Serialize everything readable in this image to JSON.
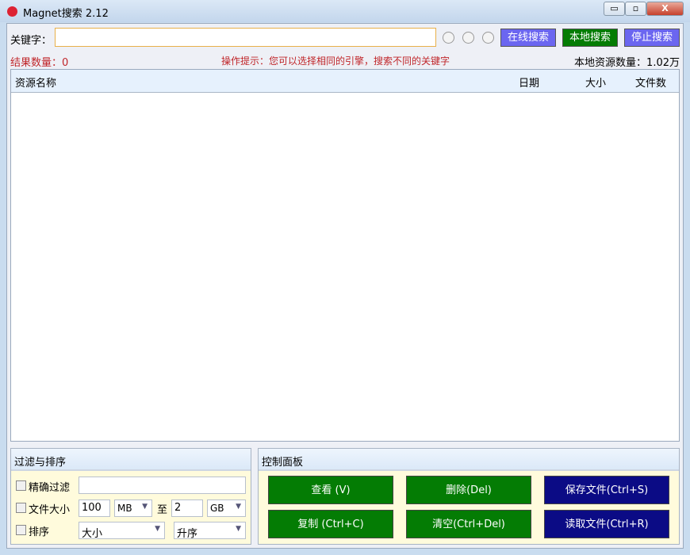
{
  "window": {
    "title": "Magnet搜索 2.12",
    "minimize": "▭",
    "maximize": "▫",
    "close": "X"
  },
  "search": {
    "keyword_label": "关键字：",
    "keyword_value": "",
    "online_btn": "在线搜索",
    "local_btn": "本地搜索",
    "stop_btn": "停止搜索"
  },
  "status": {
    "result_count": "结果数量：0",
    "hint": "操作提示：您可以选择相同的引擎，搜索不同的关键字",
    "local_count": "本地资源数量：1.02万"
  },
  "table": {
    "columns": [
      "资源名称",
      "日期",
      "大小",
      "文件数"
    ],
    "rows": []
  },
  "filter": {
    "title": "过滤与排序",
    "exact_label": "精确过滤",
    "exact_value": "",
    "size_label": "文件大小",
    "size_min": "100",
    "size_min_unit": "MB",
    "to": "至",
    "size_max": "2",
    "size_max_unit": "GB",
    "sort_label": "排序",
    "sort_field": "大小",
    "sort_order": "升序"
  },
  "control": {
    "title": "控制面板",
    "buttons": [
      "查看 (V)",
      "删除(Del)",
      "保存文件(Ctrl+S)",
      "复制 (Ctrl+C)",
      "清空(Ctrl+Del)",
      "读取文件(Ctrl+R)"
    ]
  },
  "colors": {
    "green": "#047c04",
    "navy": "#0b0b85",
    "purple": "#6b66f0",
    "red": "#c0262a"
  }
}
